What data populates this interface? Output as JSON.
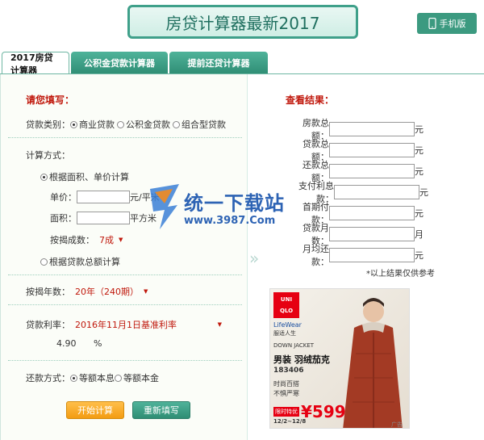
{
  "header": {
    "title": "房贷计算器最新2017",
    "mobile_label": "手机版"
  },
  "tabs": [
    {
      "label": "2017房贷计算器",
      "active": true
    },
    {
      "label": "公积金贷款计算器",
      "active": false
    },
    {
      "label": "提前还贷计算器",
      "active": false
    }
  ],
  "form": {
    "heading": "请您填写：",
    "loan_type_label": "贷款类别：",
    "loan_types": [
      "商业贷款",
      "公积金贷款",
      "组合型贷款"
    ],
    "calc_method_label": "计算方式：",
    "method_area": "根据面积、单价计算",
    "unit_price_label": "单价：",
    "unit_price_unit": "元/平米",
    "area_label": "面积：",
    "area_unit": "平方米",
    "ratio_label": "按揭成数：",
    "ratio_value": "7成",
    "method_total": "根据贷款总额计算",
    "years_label": "按揭年数：",
    "years_value": "20年（240期）",
    "rate_label": "贷款利率：",
    "rate_value": "2016年11月1日基准利率",
    "rate_number": "4.90",
    "rate_unit": "%",
    "repay_label": "还款方式：",
    "repay_options": [
      "等额本息",
      "等额本金"
    ],
    "start_button": "开始计算",
    "reset_button": "重新填写"
  },
  "results": {
    "heading": "查看结果：",
    "rows": [
      {
        "label": "房款总额：",
        "unit": "元"
      },
      {
        "label": "贷款总额：",
        "unit": "元"
      },
      {
        "label": "还款总额：",
        "unit": "元"
      },
      {
        "label": "支付利息款：",
        "unit": "元"
      },
      {
        "label": "首期付款：",
        "unit": "元"
      },
      {
        "label": "贷款月数：",
        "unit": "月"
      },
      {
        "label": "月均还款：",
        "unit": "元"
      }
    ],
    "note": "*以上结果仅供参考"
  },
  "watermark": {
    "text": "统一下载站",
    "url": "www.3987.Com"
  },
  "ad": {
    "brand_top": "UNI",
    "brand_bottom": "QLO",
    "lifewear": "LifeWear",
    "lifewear_cn": "服适人生",
    "product_en": "DOWN JACKET",
    "product_cn": "男装 羽绒茄克",
    "code": "183406",
    "slogan1": "时尚百搭",
    "slogan2": "不惧严寒",
    "limit_tag": "限时特优",
    "price": "¥599",
    "dates": "12/2~12/8",
    "ad_tag": "广告"
  }
}
